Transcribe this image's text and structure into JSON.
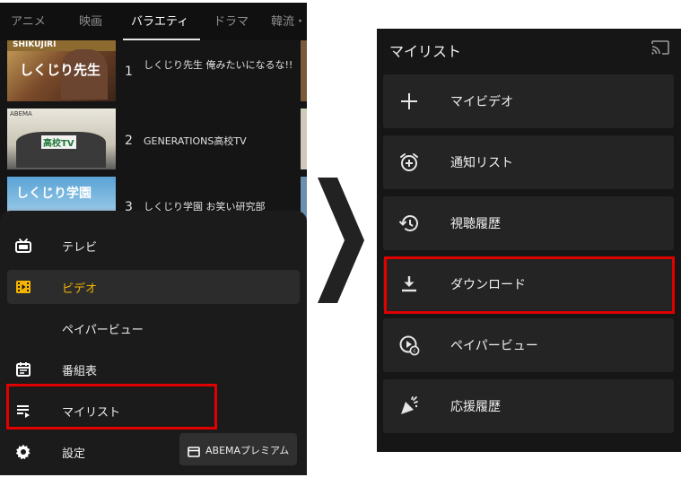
{
  "left_screen": {
    "tabs": [
      {
        "label": "アニメ",
        "active": false
      },
      {
        "label": "映画",
        "active": false
      },
      {
        "label": "バラエティ",
        "active": true
      },
      {
        "label": "ドラマ",
        "active": false
      },
      {
        "label": "韓流・",
        "active": false
      }
    ],
    "ranking": [
      {
        "rank": "1",
        "title": "しくじり先生 俺みたいになるな!!",
        "thumb_text": "しくじり先生",
        "thumb_top": "SHIKUJIRI"
      },
      {
        "rank": "2",
        "title": "GENERATIONS高校TV",
        "thumb_text": "高校TV",
        "thumb_top": "ABEMA"
      },
      {
        "rank": "3",
        "title": "しくじり学園 お笑い研究部",
        "thumb_text": "しくじり学園",
        "thumb_top": ""
      }
    ],
    "menu": [
      {
        "label": "テレビ",
        "icon": "tv-icon",
        "selected": false
      },
      {
        "label": "ビデオ",
        "icon": "video-icon",
        "selected": true
      },
      {
        "label": "ペイパービュー",
        "icon": "",
        "selected": false
      },
      {
        "label": "番組表",
        "icon": "calendar-icon",
        "selected": false
      },
      {
        "label": "マイリスト",
        "icon": "playlist-icon",
        "selected": false
      },
      {
        "label": "設定",
        "icon": "gear-icon",
        "selected": false
      }
    ],
    "premium_button": "ABEMAプレミアム"
  },
  "right_screen": {
    "title": "マイリスト",
    "items": [
      {
        "label": "マイビデオ",
        "icon": "plus-icon"
      },
      {
        "label": "通知リスト",
        "icon": "alarm-add-icon"
      },
      {
        "label": "視聴履歴",
        "icon": "history-icon"
      },
      {
        "label": "ダウンロード",
        "icon": "download-icon"
      },
      {
        "label": "ペイパービュー",
        "icon": "pay-per-view-icon"
      },
      {
        "label": "応援履歴",
        "icon": "cheer-icon"
      }
    ]
  },
  "colors": {
    "accent": "#f4b400",
    "highlight": "#e00000",
    "background": "#161616"
  }
}
